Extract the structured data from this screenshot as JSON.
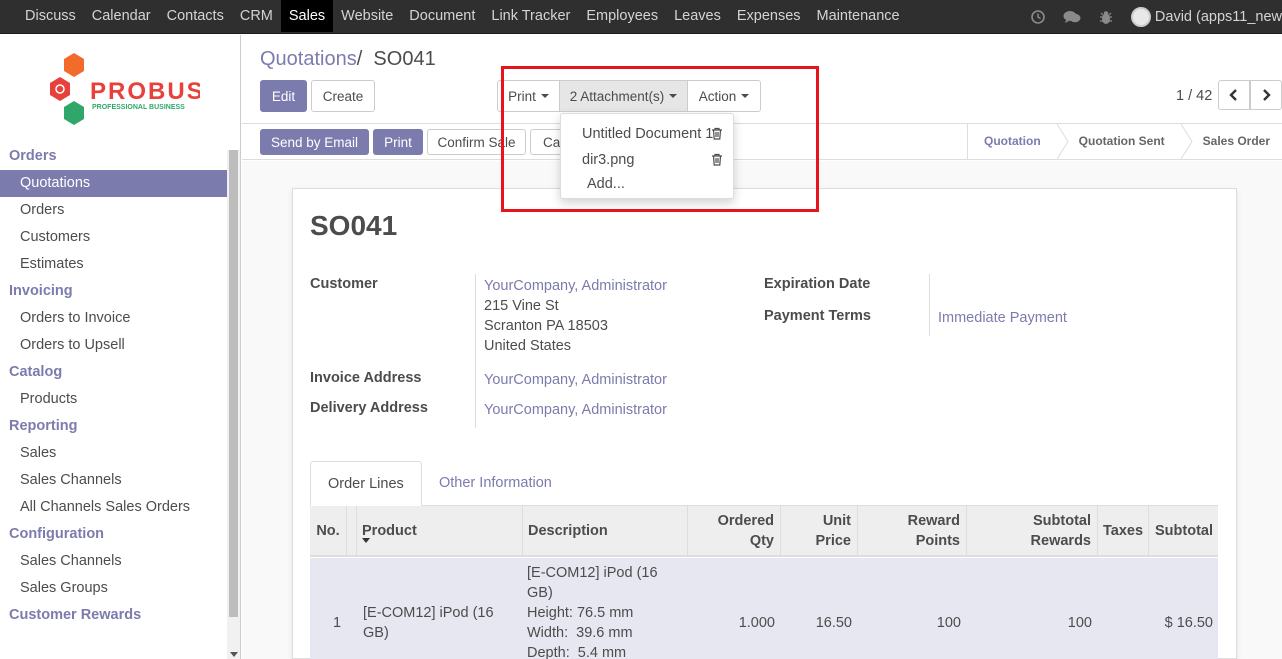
{
  "topbar": {
    "menu": [
      "Discuss",
      "Calendar",
      "Contacts",
      "CRM",
      "Sales",
      "Website",
      "Document",
      "Link Tracker",
      "Employees",
      "Leaves",
      "Expenses",
      "Maintenance"
    ],
    "active": "Sales",
    "icons": [
      "clock-icon",
      "chat-icon",
      "bug-icon"
    ],
    "user": "David (apps11_new"
  },
  "logo": {
    "brand": "PROBUSE",
    "tagline": "PROFESSIONAL BUSINESS"
  },
  "sidebar": {
    "sections": [
      {
        "header": "Orders",
        "items": [
          "Quotations",
          "Orders",
          "Customers",
          "Estimates"
        ]
      },
      {
        "header": "Invoicing",
        "items": [
          "Orders to Invoice",
          "Orders to Upsell"
        ]
      },
      {
        "header": "Catalog",
        "items": [
          "Products"
        ]
      },
      {
        "header": "Reporting",
        "items": [
          "Sales",
          "Sales Channels",
          "All Channels Sales Orders"
        ]
      },
      {
        "header": "Configuration",
        "items": [
          "Sales Channels",
          "Sales Groups"
        ]
      },
      {
        "header": "Customer Rewards",
        "items": []
      }
    ],
    "active_item": "Quotations"
  },
  "breadcrumb": {
    "parent": "Quotations",
    "separator": "/",
    "current": "SO041"
  },
  "buttons": {
    "edit": "Edit",
    "create": "Create",
    "print": "Print",
    "attachments": "2 Attachment(s)",
    "action": "Action"
  },
  "pager": {
    "value": "1 / 42"
  },
  "statusbar": {
    "buttons": {
      "send_email": "Send by Email",
      "print": "Print",
      "confirm": "Confirm Sale",
      "cancel": "Ca"
    },
    "stages": [
      "Quotation",
      "Quotation Sent",
      "Sales Order"
    ],
    "current_stage": "Quotation"
  },
  "attachments_dropdown": {
    "items": [
      "Untitled Document 1",
      "dir3.png"
    ],
    "add": "Add..."
  },
  "form": {
    "name": "SO041",
    "customer_label": "Customer",
    "customer": "YourCompany, Administrator",
    "address": [
      "215 Vine St",
      "Scranton PA 18503",
      "United States"
    ],
    "invoice_label": "Invoice Address",
    "invoice": "YourCompany, Administrator",
    "delivery_label": "Delivery Address",
    "delivery": "YourCompany, Administrator",
    "expiration_label": "Expiration Date",
    "payment_label": "Payment Terms",
    "payment": "Immediate Payment"
  },
  "tabs": [
    "Order Lines",
    "Other Information"
  ],
  "table": {
    "headers": {
      "no": "No.",
      "product": "Product",
      "description": "Description",
      "ordered_qty": [
        "Ordered",
        "Qty"
      ],
      "unit_price": [
        "Unit",
        "Price"
      ],
      "reward_points": [
        "Reward",
        "Points"
      ],
      "subtotal_rewards": [
        "Subtotal",
        "Rewards"
      ],
      "taxes": "Taxes",
      "subtotal": "Subtotal"
    },
    "rows": [
      {
        "no": "1",
        "product": [
          "[E-COM12] iPod (16",
          "GB)"
        ],
        "description": [
          "[E-COM12] iPod (16",
          "GB)",
          "Height: 76.5 mm",
          "Width:  39.6 mm",
          "Depth:  5.4 mm"
        ],
        "ordered_qty": "1.000",
        "unit_price": "16.50",
        "reward_points": "100",
        "subtotal_rewards": "100",
        "taxes": "",
        "subtotal": "$ 16.50"
      }
    ]
  },
  "colors": {
    "accent": "#7c7bad",
    "highlight_box": "#e8141b",
    "topbar": "#2f2f2f"
  }
}
